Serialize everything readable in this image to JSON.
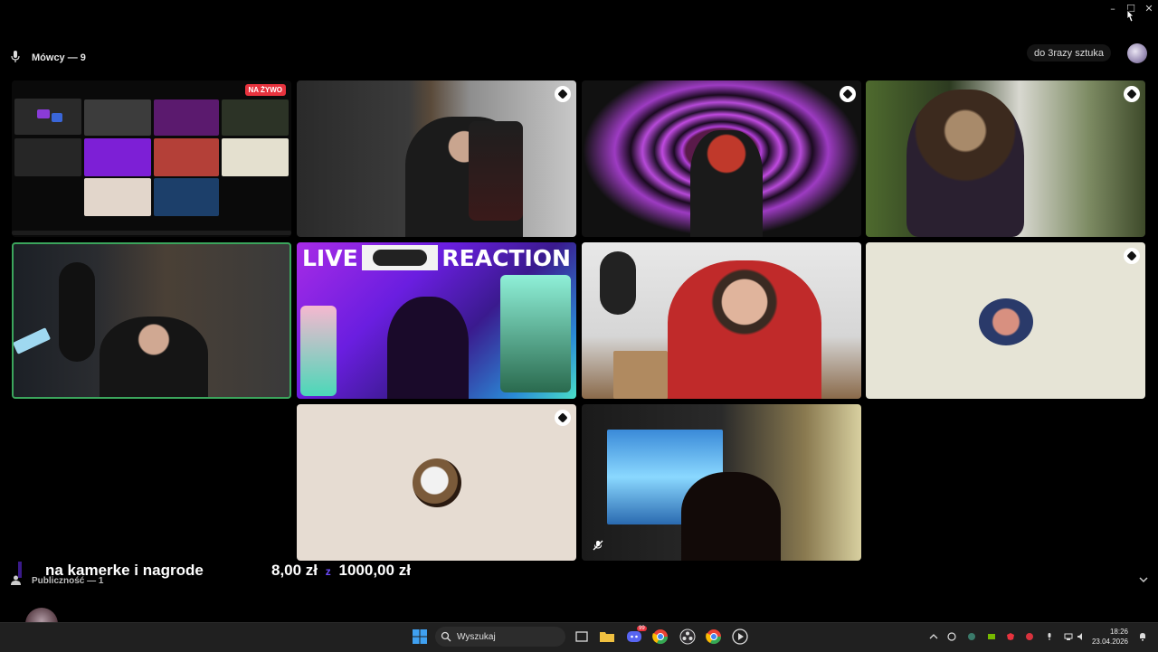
{
  "window": {
    "controls": {
      "minimize": "–",
      "maximize": "☐",
      "close": "✕"
    }
  },
  "header": {
    "speakers_label": "Mówcy — 9",
    "server_name": "do 3razy sztuka"
  },
  "tiles": {
    "live_badge": "NA ŻYWO",
    "reaction_left": "LIVE",
    "reaction_right": "REACTION"
  },
  "overlay": {
    "goal_text": "na kamerke i nagrode",
    "amount_current": "8,00 zł",
    "amount_of": "z",
    "amount_target": "1000,00 zł"
  },
  "audience": {
    "label": "Publiczność — 1"
  },
  "taskbar": {
    "search_placeholder": "Wyszukaj",
    "time": "18:26",
    "date": "23.04.2026",
    "discord_badge": "99"
  },
  "colors": {
    "accent_green": "#3ba55c",
    "live_red": "#e8333e",
    "amount_purple": "#6f4cff",
    "taskbar": "#202020"
  }
}
